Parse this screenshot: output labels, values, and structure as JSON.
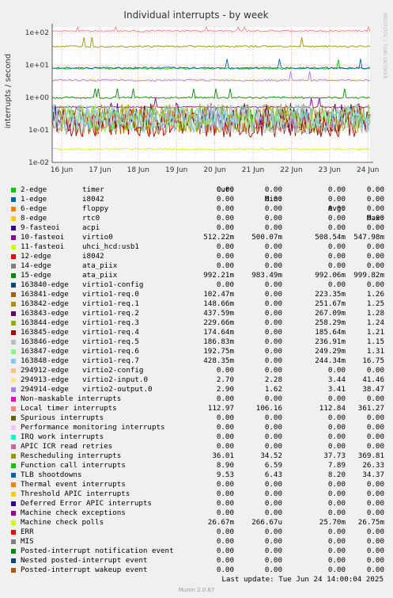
{
  "chart_data": {
    "type": "line",
    "title": "Individual interrupts - by week",
    "ylabel": "interrupts / second",
    "side_label": "RRDTOOL / TOBI OETIKER",
    "y_scale": "log",
    "ylim": [
      0.01,
      150
    ],
    "y_ticks": [
      {
        "value": 100,
        "label": "1e+02"
      },
      {
        "value": 10,
        "label": "1e+01"
      },
      {
        "value": 1,
        "label": "1e+00"
      },
      {
        "value": 0.1,
        "label": "1e-01"
      },
      {
        "value": 0.01,
        "label": "1e-02"
      }
    ],
    "x_ticks": [
      "16 Jun",
      "17 Jun",
      "18 Jun",
      "19 Jun",
      "20 Jun",
      "21 Jun",
      "22 Jun",
      "23 Jun",
      "24 Jun"
    ],
    "grid": true,
    "legend_columns": [
      "Cur:",
      "Min:",
      "Avg:",
      "Max:"
    ],
    "series": [
      {
        "name": "2-edge",
        "desc": "timer",
        "color": "#00cc00",
        "cur": "0.00",
        "min": "0.00",
        "avg": "0.00",
        "max": "0.00"
      },
      {
        "name": "1-edge",
        "desc": "i8042",
        "color": "#0066b3",
        "cur": "0.00",
        "min": "0.00",
        "avg": "0.00",
        "max": "0.00"
      },
      {
        "name": "6-edge",
        "desc": "floppy",
        "color": "#ff8000",
        "cur": "0.00",
        "min": "0.00",
        "avg": "0.00",
        "max": "0.00"
      },
      {
        "name": "8-edge",
        "desc": "rtc0",
        "color": "#ffcc00",
        "cur": "0.00",
        "min": "0.00",
        "avg": "0.00",
        "max": "0.00"
      },
      {
        "name": "9-fasteoi",
        "desc": "acpi",
        "color": "#330099",
        "cur": "0.00",
        "min": "0.00",
        "avg": "0.00",
        "max": "0.00"
      },
      {
        "name": "10-fasteoi",
        "desc": "virtio0",
        "color": "#990099",
        "cur": "512.22m",
        "min": "500.07m",
        "avg": "508.54m",
        "max": "547.98m"
      },
      {
        "name": "11-fasteoi",
        "desc": "uhci_hcd:usb1",
        "color": "#ccff00",
        "cur": "0.00",
        "min": "0.00",
        "avg": "0.00",
        "max": "0.00"
      },
      {
        "name": "12-edge",
        "desc": "i8042",
        "color": "#ff0000",
        "cur": "0.00",
        "min": "0.00",
        "avg": "0.00",
        "max": "0.00"
      },
      {
        "name": "14-edge",
        "desc": "ata_piix",
        "color": "#808080",
        "cur": "0.00",
        "min": "0.00",
        "avg": "0.00",
        "max": "0.00"
      },
      {
        "name": "15-edge",
        "desc": "ata_piix",
        "color": "#008f00",
        "cur": "992.21m",
        "min": "983.49m",
        "avg": "992.06m",
        "max": "999.82m"
      },
      {
        "name": "163840-edge",
        "desc": "virtio1-config",
        "color": "#00487d",
        "cur": "0.00",
        "min": "0.00",
        "avg": "0.00",
        "max": "0.00"
      },
      {
        "name": "163841-edge",
        "desc": "virtio1-req.0",
        "color": "#b35a00",
        "cur": "102.47m",
        "min": "0.00",
        "avg": "223.35m",
        "max": "1.26"
      },
      {
        "name": "163842-edge",
        "desc": "virtio1-req.1",
        "color": "#b38f00",
        "cur": "148.66m",
        "min": "0.00",
        "avg": "251.67m",
        "max": "1.25"
      },
      {
        "name": "163843-edge",
        "desc": "virtio1-req.2",
        "color": "#6b006b",
        "cur": "437.59m",
        "min": "0.00",
        "avg": "267.09m",
        "max": "1.28"
      },
      {
        "name": "163844-edge",
        "desc": "virtio1-req.3",
        "color": "#8fb300",
        "cur": "229.66m",
        "min": "0.00",
        "avg": "258.29m",
        "max": "1.24"
      },
      {
        "name": "163845-edge",
        "desc": "virtio1-req.4",
        "color": "#b30000",
        "cur": "174.64m",
        "min": "0.00",
        "avg": "185.64m",
        "max": "1.21"
      },
      {
        "name": "163846-edge",
        "desc": "virtio1-req.5",
        "color": "#bebebe",
        "cur": "186.83m",
        "min": "0.00",
        "avg": "236.91m",
        "max": "1.15"
      },
      {
        "name": "163847-edge",
        "desc": "virtio1-req.6",
        "color": "#80ff80",
        "cur": "192.75m",
        "min": "0.00",
        "avg": "249.29m",
        "max": "1.31"
      },
      {
        "name": "163848-edge",
        "desc": "virtio1-req.7",
        "color": "#80c9ff",
        "cur": "428.35m",
        "min": "0.00",
        "avg": "244.34m",
        "max": "16.75"
      },
      {
        "name": "294912-edge",
        "desc": "virtio2-config",
        "color": "#ffc080",
        "cur": "0.00",
        "min": "0.00",
        "avg": "0.00",
        "max": "0.00"
      },
      {
        "name": "294913-edge",
        "desc": "virtio2-input.0",
        "color": "#ffe680",
        "cur": "2.70",
        "min": "2.28",
        "avg": "3.44",
        "max": "41.46"
      },
      {
        "name": "294914-edge",
        "desc": "virtio2-output.0",
        "color": "#aa80ff",
        "cur": "2.90",
        "min": "1.62",
        "avg": "3.41",
        "max": "38.47"
      },
      {
        "name": "Non-maskable interrupts",
        "desc": "",
        "color": "#ee00cc",
        "cur": "0.00",
        "min": "0.00",
        "avg": "0.00",
        "max": "0.00"
      },
      {
        "name": "Local timer interrupts",
        "desc": "",
        "color": "#ff8080",
        "cur": "112.97",
        "min": "106.16",
        "avg": "112.84",
        "max": "361.27"
      },
      {
        "name": "Spurious interrupts",
        "desc": "",
        "color": "#666600",
        "cur": "0.00",
        "min": "0.00",
        "avg": "0.00",
        "max": "0.00"
      },
      {
        "name": "Performance monitoring interrupts",
        "desc": "",
        "color": "#ffbfff",
        "cur": "0.00",
        "min": "0.00",
        "avg": "0.00",
        "max": "0.00"
      },
      {
        "name": "IRQ work interrupts",
        "desc": "",
        "color": "#00ffcc",
        "cur": "0.00",
        "min": "0.00",
        "avg": "0.00",
        "max": "0.00"
      },
      {
        "name": "APIC ICR read retries",
        "desc": "",
        "color": "#cc6699",
        "cur": "0.00",
        "min": "0.00",
        "avg": "0.00",
        "max": "0.00"
      },
      {
        "name": "Rescheduling interrupts",
        "desc": "",
        "color": "#999900",
        "cur": "36.01",
        "min": "34.52",
        "avg": "37.73",
        "max": "369.81"
      },
      {
        "name": "Function call interrupts",
        "desc": "",
        "color": "#00cc00",
        "cur": "8.90",
        "min": "6.59",
        "avg": "7.89",
        "max": "26.33"
      },
      {
        "name": "TLB shootdowns",
        "desc": "",
        "color": "#0066b3",
        "cur": "9.53",
        "min": "6.43",
        "avg": "8.20",
        "max": "34.37"
      },
      {
        "name": "Thermal event interrupts",
        "desc": "",
        "color": "#ff8000",
        "cur": "0.00",
        "min": "0.00",
        "avg": "0.00",
        "max": "0.00"
      },
      {
        "name": "Threshold APIC interrupts",
        "desc": "",
        "color": "#ffcc00",
        "cur": "0.00",
        "min": "0.00",
        "avg": "0.00",
        "max": "0.00"
      },
      {
        "name": "Deferred Error APIC interrupts",
        "desc": "",
        "color": "#330099",
        "cur": "0.00",
        "min": "0.00",
        "avg": "0.00",
        "max": "0.00"
      },
      {
        "name": "Machine check exceptions",
        "desc": "",
        "color": "#990099",
        "cur": "0.00",
        "min": "0.00",
        "avg": "0.00",
        "max": "0.00"
      },
      {
        "name": "Machine check polls",
        "desc": "",
        "color": "#ccff00",
        "cur": "26.67m",
        "min": "266.67u",
        "avg": "25.70m",
        "max": "26.75m"
      },
      {
        "name": "ERR",
        "desc": "",
        "color": "#ff0000",
        "cur": "0.00",
        "min": "0.00",
        "avg": "0.00",
        "max": "0.00"
      },
      {
        "name": "MIS",
        "desc": "",
        "color": "#808080",
        "cur": "0.00",
        "min": "0.00",
        "avg": "0.00",
        "max": "0.00"
      },
      {
        "name": "Posted-interrupt notification event",
        "desc": "",
        "color": "#008f00",
        "cur": "0.00",
        "min": "0.00",
        "avg": "0.00",
        "max": "0.00"
      },
      {
        "name": "Nested posted-interrupt event",
        "desc": "",
        "color": "#00487d",
        "cur": "0.00",
        "min": "0.00",
        "avg": "0.00",
        "max": "0.00"
      },
      {
        "name": "Posted-interrupt wakeup event",
        "desc": "",
        "color": "#b35a00",
        "cur": "0.00",
        "min": "0.00",
        "avg": "0.00",
        "max": "0.00"
      }
    ]
  },
  "footer": {
    "last_update": "Last update: Tue Jun 24 14:00:04 2025",
    "munin_version": "Munin 2.0.67"
  }
}
